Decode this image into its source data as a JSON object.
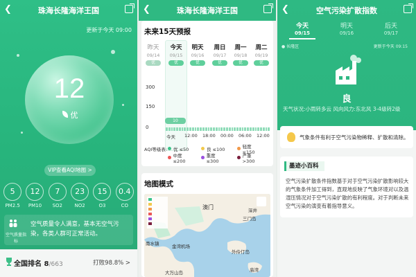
{
  "panel1": {
    "title": "珠海长隆海洋王国",
    "update_text": "更新于今天 09:00",
    "aqi_value": "12",
    "aqi_level": "优",
    "vip_button": "VIP查看AQI地图 >",
    "pollutants": [
      {
        "value": "5",
        "label": "PM2.5"
      },
      {
        "value": "12",
        "label": "PM10"
      },
      {
        "value": "7",
        "label": "SO2"
      },
      {
        "value": "23",
        "label": "NO2"
      },
      {
        "value": "15",
        "label": "O3"
      },
      {
        "value": "0.4",
        "label": "CO"
      }
    ],
    "advice_icon_label": "空气质量指标",
    "advice_text": "空气质量令人满意，基本无空气污染，各类人群可正常活动。",
    "rank_label": "全国排名",
    "rank_value": "8",
    "rank_total": "/663",
    "rank_beat": "打败98.8% >"
  },
  "panel2": {
    "title": "珠海长隆海洋王国",
    "forecast_title": "未来15天预报",
    "days": [
      {
        "name": "昨天",
        "date": "09/14",
        "pill": "优",
        "past": true
      },
      {
        "name": "今天",
        "date": "09/15",
        "pill": "优",
        "past": false
      },
      {
        "name": "明天",
        "date": "09/16",
        "pill": "优",
        "past": false
      },
      {
        "name": "周日",
        "date": "09/17",
        "pill": "优",
        "past": false
      },
      {
        "name": "周一",
        "date": "09/18",
        "pill": "优",
        "past": false
      },
      {
        "name": "周二",
        "date": "09/19",
        "pill": "优",
        "past": false
      }
    ],
    "y_labels": [
      "300",
      "150",
      "0"
    ],
    "today_value_label": "10",
    "x_labels": [
      "今天",
      "12:00",
      "18:00",
      "00:00",
      "06:00",
      "12:00"
    ],
    "legend_title": "AQI等级表:",
    "legend": [
      {
        "label": "优 ≤50",
        "color": "#3cc48a"
      },
      {
        "label": "良 ≤100",
        "color": "#f2c94c"
      },
      {
        "label": "轻度 ≤150",
        "color": "#f2994a"
      },
      {
        "label": "中度 ≤200",
        "color": "#eb5757"
      },
      {
        "label": "重度 ≤300",
        "color": "#9b51e0"
      },
      {
        "label": "严重 >300",
        "color": "#7a1f3d"
      }
    ],
    "map_title": "地图模式",
    "map_labels": [
      "澳门",
      "南水镇",
      "金湾机场",
      "大万山岛",
      "深井",
      "三门岛",
      "外伶仃岛",
      "庙湾"
    ]
  },
  "panel3": {
    "title": "空气污染扩散指数",
    "tabs": [
      {
        "name": "今天",
        "date": "09/15"
      },
      {
        "name": "明天",
        "date": "09/16"
      },
      {
        "name": "后天",
        "date": "09/17"
      }
    ],
    "location": "长隆区",
    "update_text": "更新于今天 09:15",
    "level": "良",
    "weather": "天气状况:小雨转多云  风向风力:东北风 3-4级转2级",
    "condition_text": "气象条件有利于空气污染物稀释、扩散和清除。",
    "wiki_title": "墨迹小百科",
    "wiki_body": "空气污染扩散条件指数基于对于空气污染扩散影响较大的气象条件加工得到，直观地反映了气象环境对以及温湿压情况对于空气污染扩散的有利程度。对于判断未来空气污染的演变有着指导意义。"
  }
}
